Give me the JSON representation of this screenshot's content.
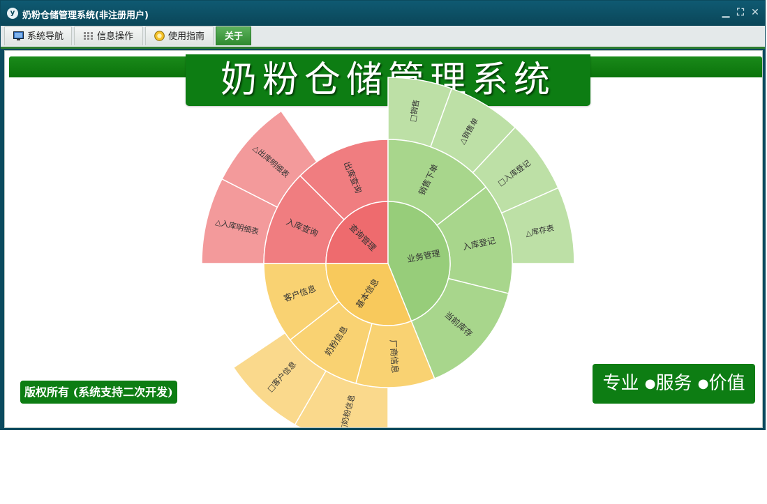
{
  "window": {
    "title": "奶粉仓储管理系统(非注册用户)",
    "app_icon_label": "y",
    "controls": [
      "minimize-icon",
      "restore-icon",
      "close-icon"
    ]
  },
  "menu": {
    "items": [
      {
        "label": "系统导航",
        "icon": "monitor-icon"
      },
      {
        "label": "信息操作",
        "icon": "grid-icon"
      },
      {
        "label": "使用指南",
        "icon": "help-icon"
      },
      {
        "label": "关于",
        "icon": "",
        "active": true
      }
    ]
  },
  "banner": {
    "title": "奶粉仓储管理系统"
  },
  "copyright": "版权所有 (系统支持二次开发)",
  "slogan": {
    "items": [
      "专业",
      "服务",
      "价值"
    ],
    "separator": "●"
  },
  "colors": {
    "titlebar": "#0a4658",
    "brand_green": "#0d7d13",
    "red_core": "#ee6b6e",
    "red_mid": "#f07d80",
    "red_outer": "#f39a9b",
    "green_core": "#97cd7a",
    "green_mid": "#a8d68c",
    "green_outer": "#bde0a6",
    "yellow_core": "#f8c95c",
    "yellow_mid": "#f9d272",
    "yellow_outer": "#fad98c"
  },
  "sunburst": {
    "center": "sunburst-chart",
    "rings": {
      "core": [
        {
          "label": "查询管理",
          "group": "red"
        },
        {
          "label": "业务管理",
          "group": "green"
        },
        {
          "label": "基本信息",
          "group": "yellow"
        }
      ],
      "middle": [
        {
          "label": "入库查询",
          "group": "red"
        },
        {
          "label": "出库查询",
          "group": "red"
        },
        {
          "label": "销售下单",
          "group": "green"
        },
        {
          "label": "入库登记",
          "group": "green"
        },
        {
          "label": "当前库存",
          "group": "green"
        },
        {
          "label": "厂商信息",
          "group": "yellow"
        },
        {
          "label": "奶粉信息",
          "group": "yellow"
        },
        {
          "label": "客户信息",
          "group": "yellow"
        }
      ],
      "outer": [
        {
          "label": "入库明细表",
          "group": "red",
          "marker": "△"
        },
        {
          "label": "出库明细表",
          "group": "red",
          "marker": "△"
        },
        {
          "label": "销售",
          "group": "green",
          "marker": "□"
        },
        {
          "label": "销售单",
          "group": "green",
          "marker": "△"
        },
        {
          "label": "入库登记",
          "group": "green",
          "marker": "□"
        },
        {
          "label": "库存表",
          "group": "green",
          "marker": "△"
        },
        {
          "label": "奶粉信息",
          "group": "yellow",
          "marker": "□"
        },
        {
          "label": "客户信息",
          "group": "yellow",
          "marker": "□"
        }
      ]
    }
  }
}
